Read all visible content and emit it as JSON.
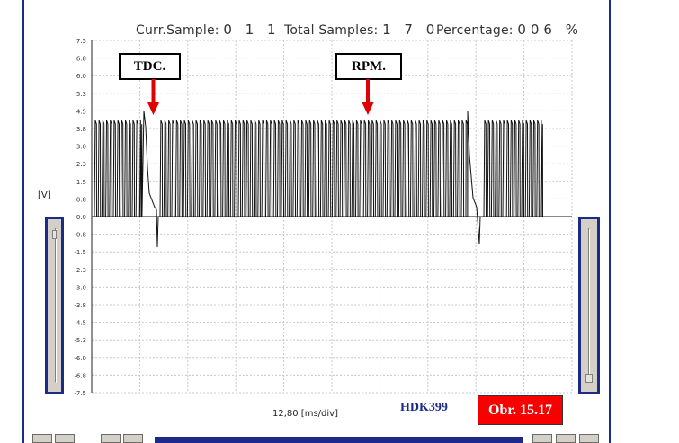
{
  "header": {
    "curr_label": "Curr.Sample:",
    "curr_value": "0 1 1",
    "total_label": "Total Samples:",
    "total_value": "1 7 0",
    "pct_label": "Percentage:",
    "pct_value": "006 %"
  },
  "y_unit": "[V]",
  "y_ticks": [
    "7.5",
    "6.8",
    "6.0",
    "5.3",
    "4.5",
    "3.8",
    "3.0",
    "2.3",
    "1.5",
    "0.8",
    "0.0",
    "-0.8",
    "-1.5",
    "-2.3",
    "-3.0",
    "-3.8",
    "-4.5",
    "-5.3",
    "-6.0",
    "-6.8",
    "-7.5"
  ],
  "x_scale": "12,80 [ms/div]",
  "callouts": {
    "tdc": "TDC.",
    "rpm": "RPM."
  },
  "code": "HDK399",
  "figure_label": "Obr. 15.17",
  "colors": {
    "frame": "#1c2b8a",
    "figure_bg": "#f80000",
    "arrow": "#e00000",
    "grid": "#c8c8c8"
  },
  "chart_data": {
    "type": "line",
    "ylabel": "[V]",
    "ylim": [
      -7.5,
      7.5
    ],
    "xlabel": "12,80 [ms/div]",
    "grid": true,
    "description_values": {
      "baseline_v": 0.0,
      "pulse_peak_v": 4.1,
      "tdc_spike_v": 4.5,
      "negative_spike_v": -1.3
    }
  }
}
